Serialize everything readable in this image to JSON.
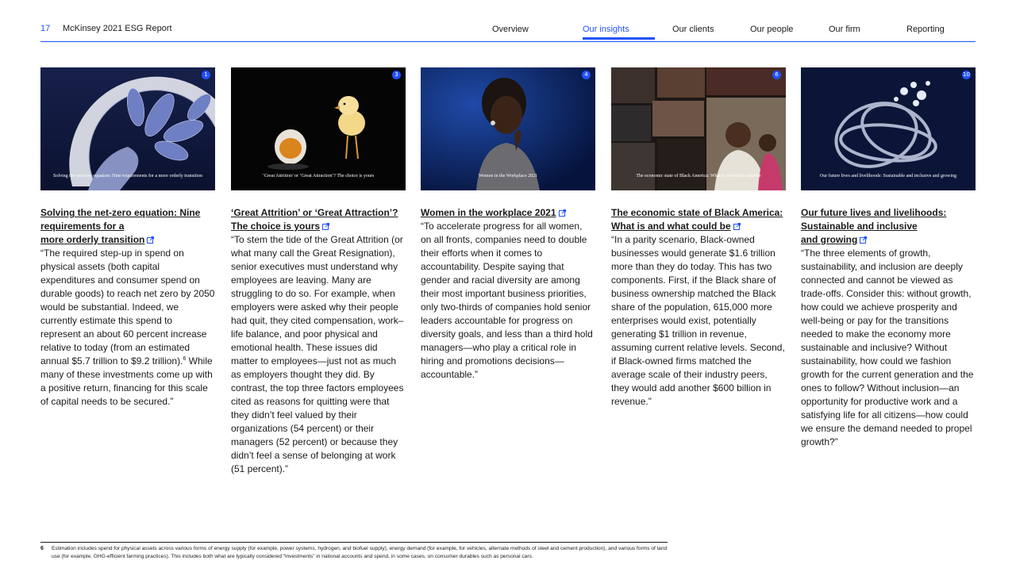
{
  "header": {
    "page_number": "17",
    "report_title": "McKinsey 2021 ESG Report",
    "nav": [
      "Overview",
      "Our insights",
      "Our clients",
      "Our people",
      "Our firm",
      "Reporting"
    ],
    "active_nav": "Our insights"
  },
  "colors": {
    "accent": "#2251ff",
    "text": "#1a1a1a"
  },
  "cards": [
    {
      "badge": "1",
      "image_caption": "Solving the net-zero equation: Nine requirements for a more orderly transition",
      "title_lines": [
        "Solving the net-zero equation: Nine",
        "requirements for a",
        "more orderly transition"
      ],
      "body": "“The required step-up in spend on physical assets (both capital expenditures and consumer spend on durable goods) to reach net zero by 2050 would be substantial. Indeed, we currently estimate this spend to represent an about 60 percent increase relative to today (from an estimated annual $5.7 trillion to $9.2 trillion).",
      "body_sup": "6",
      "body_after": " While many of these investments come up with a positive return, financing for this scale of capital needs to be secured.”"
    },
    {
      "badge": "3",
      "image_caption": "‘Great Attrition’ or ‘Great Attraction’? The choice is yours",
      "title_lines": [
        "‘Great Attrition’ or ‘Great Attraction’?",
        "The choice is yours"
      ],
      "body": "“To stem the tide of the Great Attrition (or what many call the Great Resignation), senior executives must understand why employees are leaving. Many are struggling to do so. For example, when employers were asked why their people had quit, they cited compensation, work–life balance, and poor physical and emotional health. These issues did matter to employees—just not as much as employers thought they did. By contrast, the top three factors employees cited as reasons for quitting were that they didn’t feel valued by their organizations (54 percent) or their managers (52 percent) or because they didn’t feel a sense of belonging at work (51 percent).”"
    },
    {
      "badge": "4",
      "image_caption": "Women in the Workplace 2021",
      "title_lines": [
        "Women in the workplace 2021"
      ],
      "body": "“To accelerate progress for all women, on all fronts, companies need to double their efforts when it comes to accountability. Despite saying that gender and racial diversity are among their most important business priorities, only two-thirds of companies hold senior leaders accountable for progress on diversity goals, and less than a third hold managers—who play a critical role in hiring and promotions decisions—accountable.”"
    },
    {
      "badge": "6",
      "image_caption": "The economic state of Black America: What is and what could be",
      "title_lines": [
        "The economic state of Black America:",
        "What is and what could be"
      ],
      "body": "“In a parity scenario, Black-owned businesses would generate $1.6 trillion more than they do today. This has two components. First, if the Black share of business ownership matched the Black share of the population, 615,000 more enterprises would exist, potentially generating $1 trillion in revenue, assuming current relative levels. Second, if Black-owned firms matched the average scale of their industry peers, they would add another $600 billion in revenue.”"
    },
    {
      "badge": "10",
      "image_caption": "Our future lives and livelihoods: Sustainable and inclusive and growing",
      "title_lines": [
        "Our future lives and livelihoods:",
        "Sustainable and inclusive",
        "and growing"
      ],
      "body": "“The three elements of growth, sustainability, and inclusion are deeply connected and cannot be viewed as trade-offs. Consider this: without growth, how could we achieve prosperity and well-being or pay for the transitions needed to make the economy more sustainable and inclusive? Without sustainability, how could we fashion growth for the current generation and the ones to follow? Without inclusion—an opportunity for productive work and a satisfying life for all citizens—how could we ensure the demand needed to propel growth?”"
    }
  ],
  "footnote": {
    "number": "6",
    "text": "Estimation includes spend for physical assets across various forms of energy supply (for example, power systems, hydrogen, and biofuel supply), energy demand (for example, for vehicles, alternate methods of steel and cement production), and various forms of land use (for example, GHG-efficient farming practices). This includes both what are typically considered “investments” in national accounts and spend, in some cases, on consumer durables such as personal cars."
  }
}
